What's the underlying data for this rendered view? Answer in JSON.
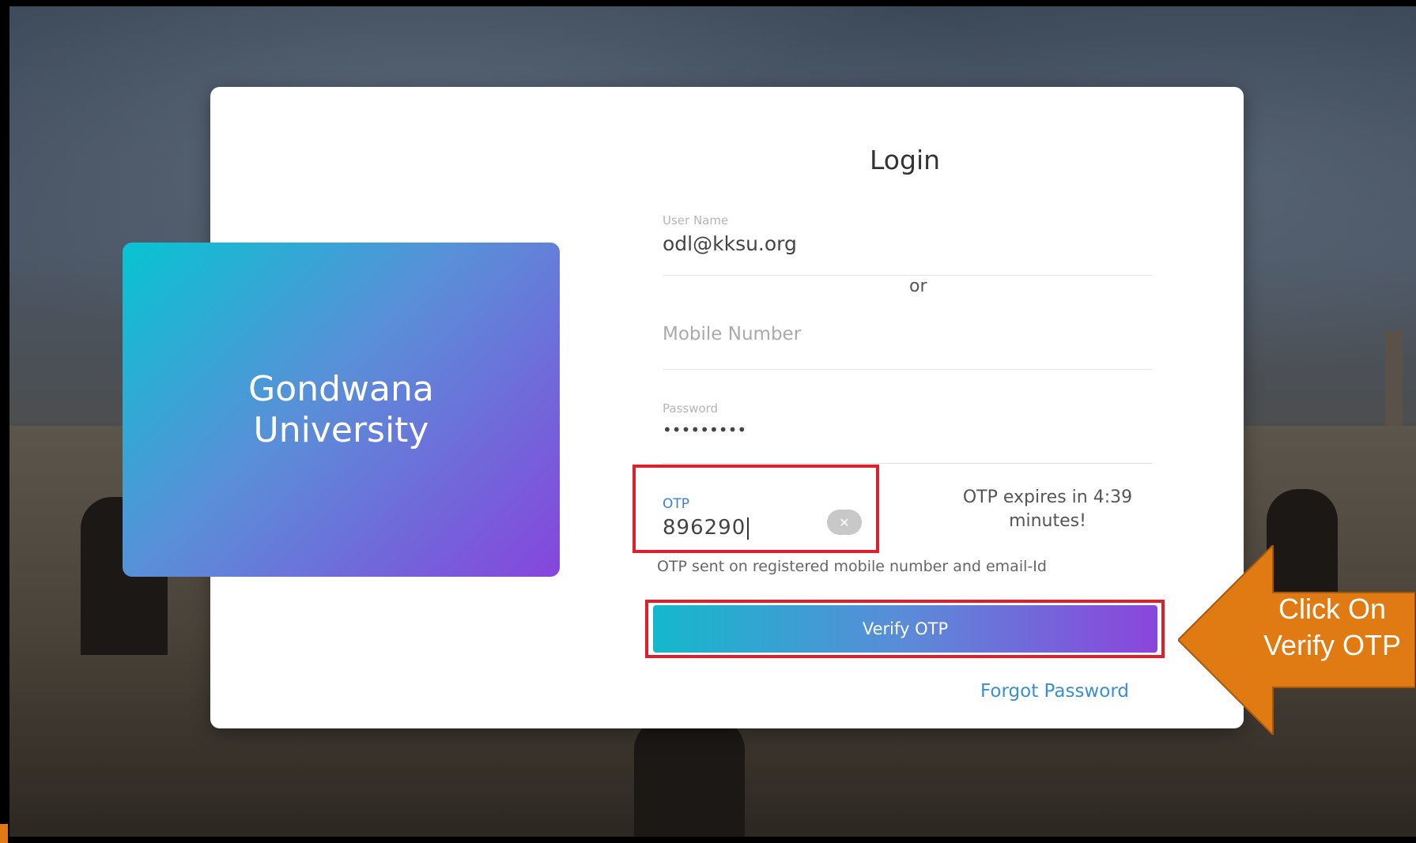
{
  "brand": {
    "name": "Gondwana University"
  },
  "login": {
    "title": "Login",
    "username_label": "User Name",
    "username_value": "odl@kksu.org",
    "or_text": "or",
    "mobile_placeholder": "Mobile Number",
    "password_label": "Password",
    "password_value": "•••••••••",
    "otp_label": "OTP",
    "otp_value": "896290",
    "otp_expiry": "OTP expires in 4:39 minutes!",
    "otp_note": "OTP sent on registered mobile number and email-Id",
    "verify_button": "Verify OTP",
    "forgot_link": "Forgot Password"
  },
  "callout": {
    "text": "Click On Verify OTP"
  },
  "colors": {
    "highlight_border": "#e01e2c",
    "callout_arrow": "#e07a12",
    "link": "#3a8fd0",
    "gradient_start": "#07c4d2",
    "gradient_end": "#8645dc"
  },
  "icons": {
    "otp_clear": "close-circle-icon"
  }
}
